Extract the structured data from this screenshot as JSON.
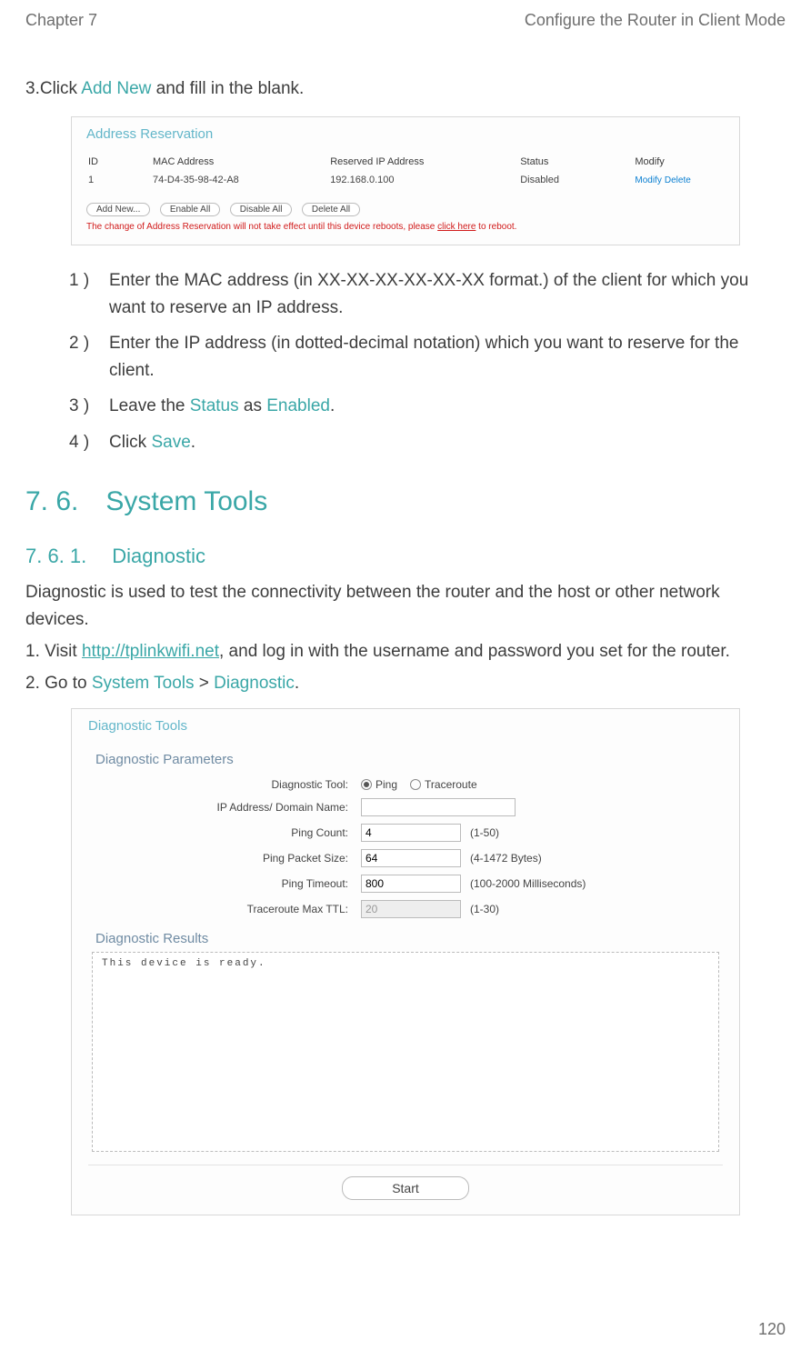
{
  "header": {
    "chapter": "Chapter 7",
    "title": "Configure the Router in Client Mode"
  },
  "step3": {
    "prefix": "3. ",
    "text_before": "Click ",
    "link": "Add New",
    "text_after": " and fill in the blank."
  },
  "reservation_panel": {
    "title": "Address Reservation",
    "headers": [
      "ID",
      "MAC Address",
      "Reserved IP Address",
      "Status",
      "Modify"
    ],
    "row": {
      "id": "1",
      "mac": "74-D4-35-98-42-A8",
      "ip": "192.168.0.100",
      "status": "Disabled",
      "modify": "Modify",
      "delete": "Delete"
    },
    "buttons": [
      "Add New...",
      "Enable All",
      "Disable All",
      "Delete All"
    ],
    "warning_before": "The change of Address Reservation will not take effect until this device reboots, please ",
    "warning_link": "click here",
    "warning_after": " to reboot."
  },
  "sub_steps": [
    {
      "marker": "1 )",
      "text_before": "Enter the MAC address (in XX-XX-XX-XX-XX-XX format.) of the client for which you want to reserve an IP address."
    },
    {
      "marker": "2 )",
      "text_before": "Enter the IP address (in dotted-decimal notation) which you want to reserve for the client."
    },
    {
      "marker": "3 )",
      "text_a": "Leave the ",
      "link_a": "Status",
      "text_b": " as ",
      "link_b": "Enabled",
      "text_c": "."
    },
    {
      "marker": "4 )",
      "text_a": "Click ",
      "link_a": "Save",
      "text_c": "."
    }
  ],
  "h2": {
    "num": "7. 6.",
    "text": "System Tools"
  },
  "h3": {
    "num": "7. 6. 1.",
    "text": "Diagnostic"
  },
  "diag_intro": "Diagnostic is used to test the connectivity between the router and the host or other network devices.",
  "diag_steps": {
    "s1_prefix": "1. ",
    "s1_a": "Visit ",
    "s1_link": "http://tplinkwifi.net",
    "s1_b": ", and log in with the username and password you set for the router.",
    "s2_prefix": "2. ",
    "s2_a": "Go to ",
    "s2_link_a": "System Tools",
    "s2_mid": " > ",
    "s2_link_b": "Diagnostic",
    "s2_end": "."
  },
  "diag_panel": {
    "title": "Diagnostic Tools",
    "params_title": "Diagnostic Parameters",
    "rows": {
      "tool_label": "Diagnostic Tool:",
      "tool_opt1": "Ping",
      "tool_opt2": "Traceroute",
      "ip_label": "IP Address/ Domain Name:",
      "ip_value": "",
      "count_label": "Ping Count:",
      "count_value": "4",
      "count_hint": "(1-50)",
      "size_label": "Ping Packet Size:",
      "size_value": "64",
      "size_hint": "(4-1472 Bytes)",
      "timeout_label": "Ping Timeout:",
      "timeout_value": "800",
      "timeout_hint": "(100-2000 Milliseconds)",
      "ttl_label": "Traceroute Max TTL:",
      "ttl_value": "20",
      "ttl_hint": "(1-30)"
    },
    "results_title": "Diagnostic Results",
    "results_text": "This device is ready.",
    "start": "Start"
  },
  "page_number": "120"
}
